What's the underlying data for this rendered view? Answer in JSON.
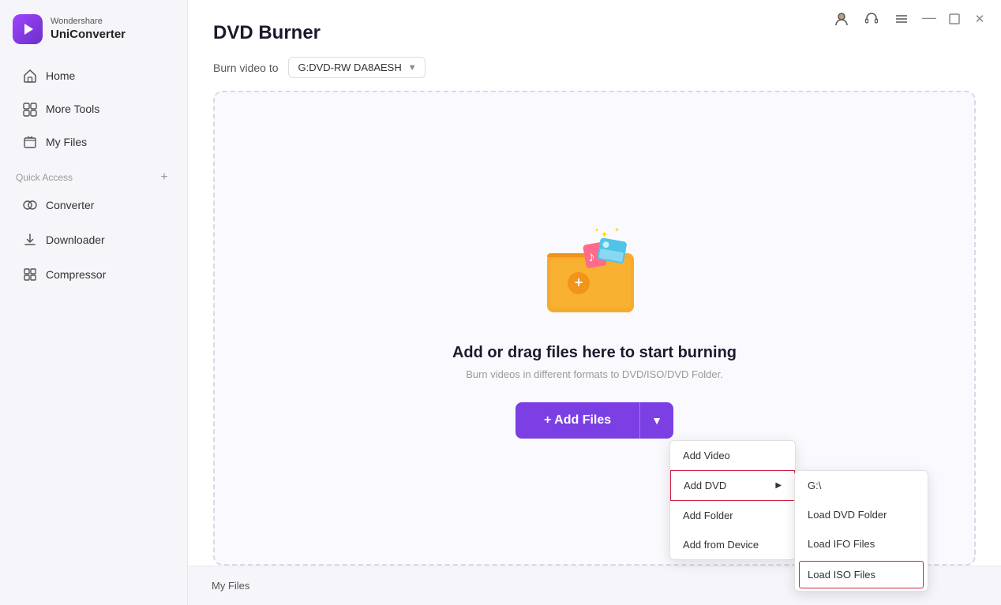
{
  "app": {
    "brand": "Wondershare",
    "product": "UniConverter"
  },
  "sidebar": {
    "nav_items": [
      {
        "id": "home",
        "label": "Home"
      },
      {
        "id": "more-tools",
        "label": "More Tools"
      },
      {
        "id": "my-files",
        "label": "My Files"
      }
    ],
    "section_label": "Quick Access",
    "quick_access": [
      {
        "id": "converter",
        "label": "Converter"
      },
      {
        "id": "downloader",
        "label": "Downloader"
      },
      {
        "id": "compressor",
        "label": "Compressor"
      }
    ]
  },
  "titlebar": {
    "minimize_label": "—",
    "maximize_label": "□",
    "close_label": "✕"
  },
  "page": {
    "title": "DVD Burner",
    "burn_label": "Burn video to",
    "burn_device": "G:DVD-RW DA8AESH"
  },
  "dropzone": {
    "title": "Add or drag files here to start burning",
    "subtitle": "Burn videos in different formats to DVD/ISO/DVD Folder."
  },
  "add_files_btn": "+ Add Files",
  "dropdown_menu": {
    "items": [
      {
        "id": "add-video",
        "label": "Add Video",
        "has_submenu": false
      },
      {
        "id": "add-dvd",
        "label": "Add DVD",
        "has_submenu": true,
        "active": true
      },
      {
        "id": "add-folder",
        "label": "Add Folder",
        "has_submenu": false
      },
      {
        "id": "add-from-device",
        "label": "Add from Device",
        "has_submenu": false
      }
    ],
    "add_dvd_submenu": [
      {
        "id": "g-drive",
        "label": "G:\\"
      },
      {
        "id": "load-dvd-folder",
        "label": "Load DVD Folder"
      },
      {
        "id": "load-ifo-files",
        "label": "Load IFO Files"
      },
      {
        "id": "load-iso-files",
        "label": "Load ISO Files",
        "highlighted": true
      }
    ]
  },
  "footer": {
    "tab_label": "My Files"
  }
}
